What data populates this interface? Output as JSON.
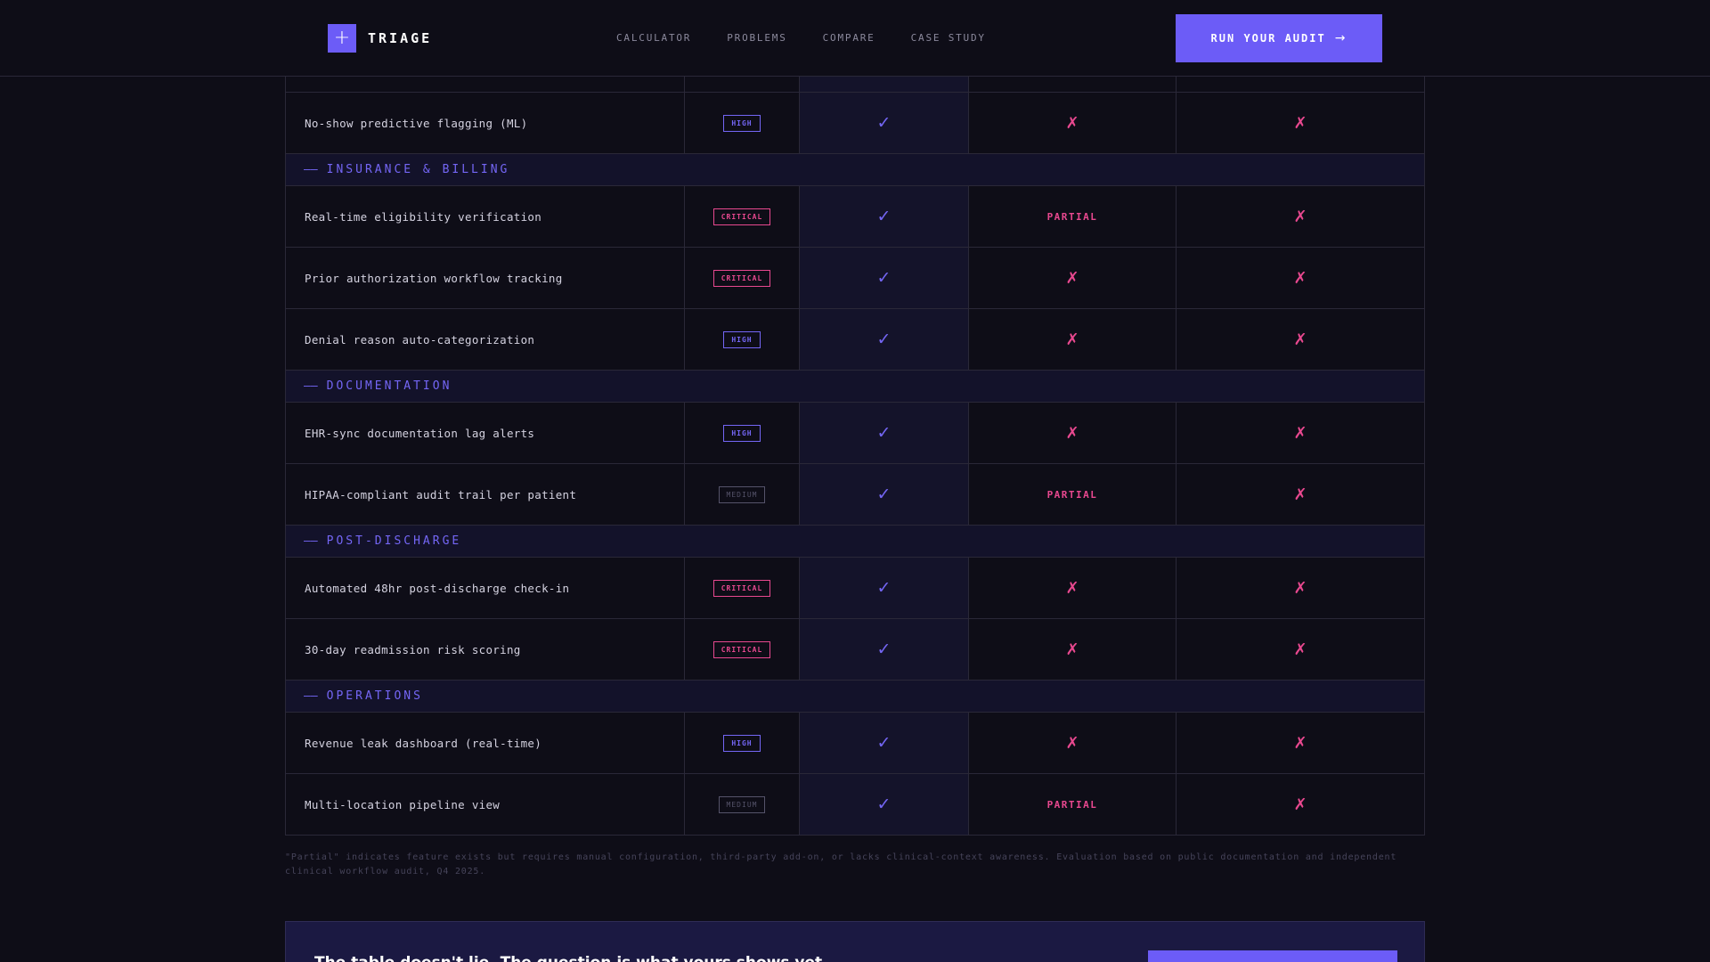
{
  "header": {
    "logo_mark": "+",
    "brand": "TRIAGE",
    "nav": [
      "CALCULATOR",
      "PROBLEMS",
      "COMPARE",
      "CASE STUDY"
    ],
    "cta_label": "RUN YOUR AUDIT",
    "cta_arrow": "→"
  },
  "symbols": {
    "check": "✓",
    "cross": "✗",
    "category_dash": "——"
  },
  "table": {
    "rows": [
      {
        "kind": "feature",
        "feature": "No-show predictive flagging (ML)",
        "priority": "HIGH",
        "triage": "check",
        "competitor_a": "cross",
        "competitor_b": "cross"
      },
      {
        "kind": "category",
        "label": "INSURANCE & BILLING"
      },
      {
        "kind": "feature",
        "feature": "Real-time eligibility verification",
        "priority": "CRITICAL",
        "triage": "check",
        "competitor_a": "PARTIAL",
        "competitor_b": "cross"
      },
      {
        "kind": "feature",
        "feature": "Prior authorization workflow tracking",
        "priority": "CRITICAL",
        "triage": "check",
        "competitor_a": "cross",
        "competitor_b": "cross"
      },
      {
        "kind": "feature",
        "feature": "Denial reason auto-categorization",
        "priority": "HIGH",
        "triage": "check",
        "competitor_a": "cross",
        "competitor_b": "cross"
      },
      {
        "kind": "category",
        "label": "DOCUMENTATION"
      },
      {
        "kind": "feature",
        "feature": "EHR-sync documentation lag alerts",
        "priority": "HIGH",
        "triage": "check",
        "competitor_a": "cross",
        "competitor_b": "cross"
      },
      {
        "kind": "feature",
        "feature": "HIPAA-compliant audit trail per patient",
        "priority": "MEDIUM",
        "triage": "check",
        "competitor_a": "PARTIAL",
        "competitor_b": "cross"
      },
      {
        "kind": "category",
        "label": "POST-DISCHARGE"
      },
      {
        "kind": "feature",
        "feature": "Automated 48hr post-discharge check-in",
        "priority": "CRITICAL",
        "triage": "check",
        "competitor_a": "cross",
        "competitor_b": "cross"
      },
      {
        "kind": "feature",
        "feature": "30-day readmission risk scoring",
        "priority": "CRITICAL",
        "triage": "check",
        "competitor_a": "cross",
        "competitor_b": "cross"
      },
      {
        "kind": "category",
        "label": "OPERATIONS"
      },
      {
        "kind": "feature",
        "feature": "Revenue leak dashboard (real-time)",
        "priority": "HIGH",
        "triage": "check",
        "competitor_a": "cross",
        "competitor_b": "cross"
      },
      {
        "kind": "feature",
        "feature": "Multi-location pipeline view",
        "priority": "MEDIUM",
        "triage": "check",
        "competitor_a": "PARTIAL",
        "competitor_b": "cross"
      }
    ]
  },
  "footnote": "\"Partial\" indicates feature exists but requires manual configuration, third-party add-on, or lacks clinical-context awareness. Evaluation based on public documentation and independent clinical workflow audit, Q4 2025.",
  "banner": {
    "text": "The table doesn't lie. The question is what yours shows yet"
  },
  "colors": {
    "accent": "#6c5cf7",
    "critical": "#e8488f",
    "background": "#0e0d17",
    "border": "#2a2838"
  }
}
